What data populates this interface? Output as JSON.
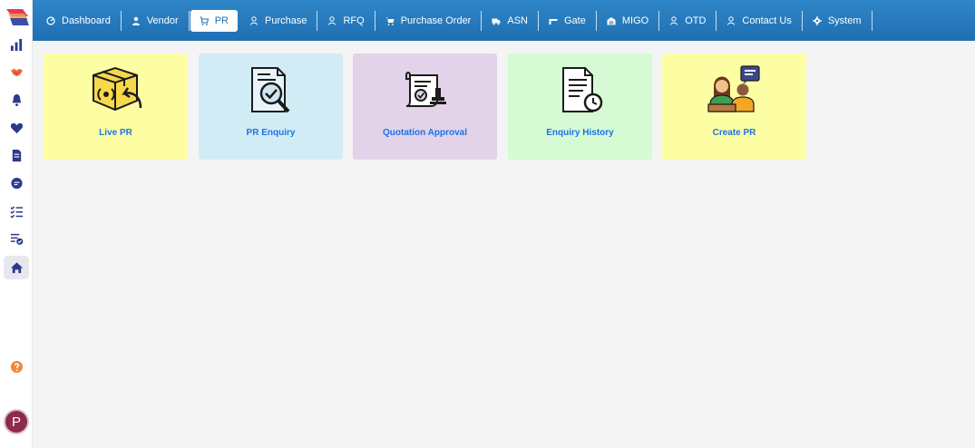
{
  "nav": {
    "items": [
      {
        "label": "Dashboard",
        "icon": "gauge-icon"
      },
      {
        "label": "Vendor",
        "icon": "user-icon"
      },
      {
        "label": "PR",
        "icon": "cart-icon",
        "active": true
      },
      {
        "label": "Purchase",
        "icon": "user-icon"
      },
      {
        "label": "RFQ",
        "icon": "user-icon"
      },
      {
        "label": "Purchase Order",
        "icon": "cart-icon"
      },
      {
        "label": "ASN",
        "icon": "truck-icon"
      },
      {
        "label": "Gate",
        "icon": "gate-icon"
      },
      {
        "label": "MIGO",
        "icon": "warehouse-icon"
      },
      {
        "label": "OTD",
        "icon": "user-icon"
      },
      {
        "label": "Contact Us",
        "icon": "user-icon"
      },
      {
        "label": "System",
        "icon": "gear-icon"
      }
    ]
  },
  "sidebar": {
    "items": [
      "bar-chart-icon",
      "handshake-icon",
      "bell-icon",
      "heart-icon",
      "document-icon",
      "chat-icon",
      "checklist-icon",
      "approval-list-icon",
      "home-icon",
      "help-icon"
    ],
    "active": "home-icon",
    "avatar_initial": "P"
  },
  "cards": [
    {
      "label": "Live PR",
      "icon": "live-pr-icon",
      "color": "#fdfea3"
    },
    {
      "label": "PR Enquiry",
      "icon": "pr-enquiry-icon",
      "color": "#d1ecf5"
    },
    {
      "label": "Quotation Approval",
      "icon": "quotation-approval-icon",
      "color": "#e2d3e8"
    },
    {
      "label": "Enquiry History",
      "icon": "enquiry-history-icon",
      "color": "#d6fbd4"
    },
    {
      "label": "Create PR",
      "icon": "create-pr-icon",
      "color": "#fdfea3"
    }
  ],
  "colors": {
    "nav_bg": "#1f6fb2",
    "card_label": "#1a73e8"
  }
}
